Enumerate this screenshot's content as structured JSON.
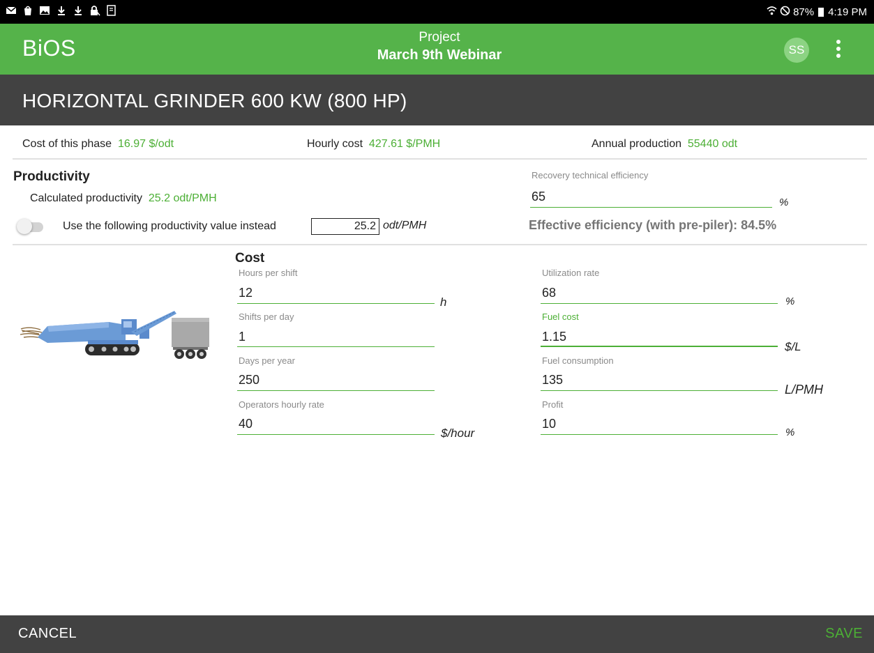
{
  "status_bar": {
    "left_icons": [
      "mail-icon",
      "bag-icon",
      "image-icon",
      "download-icon",
      "download-icon",
      "lock-icon",
      "file-icon"
    ],
    "wifi_icon": "wifi-icon",
    "dnd_icon": "do-not-disturb-icon",
    "battery": "87%",
    "time": "4:19 PM"
  },
  "app_bar": {
    "brand": "BiOS",
    "project_label": "Project",
    "project_name": "March 9th Webinar",
    "avatar_initials": "SS",
    "menu_icon": "more-vert-icon",
    "color": "#55b34a"
  },
  "machine": {
    "title": "HORIZONTAL GRINDER 600 KW (800 HP)"
  },
  "summary": {
    "cost_label": "Cost of this phase",
    "cost_value": "16.97 $/odt",
    "hourly_label": "Hourly cost",
    "hourly_value": "427.61 $/PMH",
    "annual_label": "Annual production",
    "annual_value": "55440 odt"
  },
  "productivity": {
    "heading": "Productivity",
    "calculated_label": "Calculated productivity",
    "calculated_value": "25.2 odt/PMH",
    "override_label": "Use the following productivity value instead",
    "override_value": "25.2",
    "override_unit": "odt/PMH",
    "override_enabled": false,
    "recovery_label": "Recovery technical efficiency",
    "recovery_value": "65",
    "recovery_unit": "%",
    "effective_text": "Effective efficiency (with pre-piler): 84.5%"
  },
  "cost": {
    "heading": "Cost",
    "hours_label": "Hours per shift",
    "hours_value": "12",
    "hours_unit": "h",
    "shifts_label": "Shifts per day",
    "shifts_value": "1",
    "days_label": "Days per year",
    "days_value": "250",
    "operators_label": "Operators hourly rate",
    "operators_value": "40",
    "operators_unit": "$/hour",
    "utilization_label": "Utilization rate",
    "utilization_value": "68",
    "utilization_unit": "%",
    "fuel_cost_label": "Fuel cost",
    "fuel_cost_value": "1.15",
    "fuel_cost_unit": "$/L",
    "fuel_consumption_label": "Fuel consumption",
    "fuel_consumption_value": "135",
    "fuel_consumption_unit": "L/PMH",
    "profit_label": "Profit",
    "profit_value": "10",
    "profit_unit": "%"
  },
  "bottom_bar": {
    "cancel_label": "CANCEL",
    "save_label": "SAVE"
  }
}
